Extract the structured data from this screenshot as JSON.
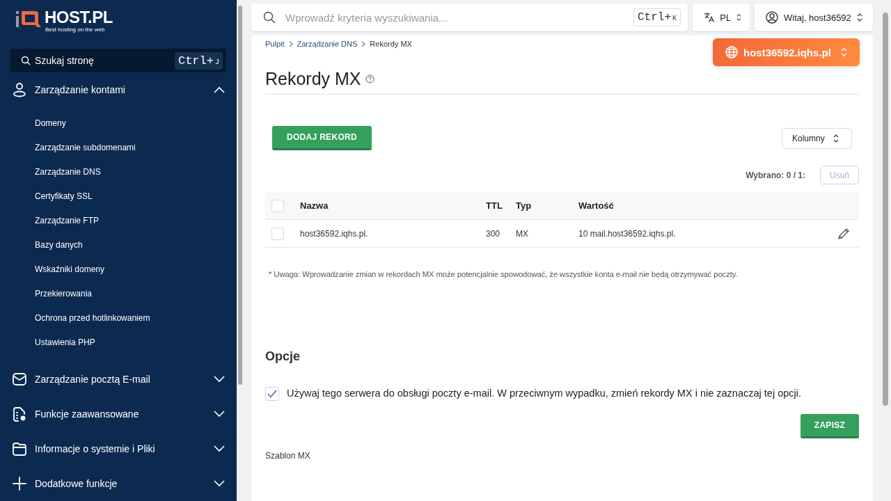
{
  "logo": {
    "name": "HOST.PL",
    "tagline": "Best hosting on the web"
  },
  "sidebar": {
    "search": {
      "placeholder": "Szukaj stronę",
      "shortcut_main": "Ctrl+",
      "shortcut_key": "J"
    },
    "groups": [
      {
        "label": "Zarządzanie kontami",
        "kind": "user",
        "expanded": true,
        "children": [
          {
            "label": "Domeny"
          },
          {
            "label": "Zarządzanie subdomenami"
          },
          {
            "label": "Zarządzanie DNS"
          },
          {
            "label": "Certyfikaty SSL"
          },
          {
            "label": "Zarządzanie FTP"
          },
          {
            "label": "Bazy danych"
          },
          {
            "label": "Wskaźniki domeny"
          },
          {
            "label": "Przekierowania"
          },
          {
            "label": "Ochrona przed hotlinkowaniem"
          },
          {
            "label": "Ustawienia PHP"
          }
        ]
      },
      {
        "label": "Zarządzanie pocztą E-mail",
        "kind": "mail",
        "expanded": false
      },
      {
        "label": "Funkcje zaawansowane",
        "kind": "doc-gear",
        "expanded": false
      },
      {
        "label": "Informacje o systemie i Pliki",
        "kind": "folder",
        "expanded": false
      },
      {
        "label": "Dodatkowe funkcje",
        "kind": "plus",
        "expanded": false
      }
    ]
  },
  "topbar": {
    "search": {
      "placeholder": "Wprowadź kryteria wyszukiwania...",
      "shortcut_main": "Ctrl+",
      "shortcut_key": "K"
    },
    "language": "PL",
    "user": "Witaj, host36592"
  },
  "breadcrumb": [
    "Pulpit",
    "Zarządzanie DNS",
    "Rekordy MX"
  ],
  "domain": "host36592.iqhs.pl",
  "title": "Rekordy MX",
  "add_button": "DODAJ REKORD",
  "columns_button": "Kolumny",
  "selected_count": "Wybrano: 0 / 1:",
  "delete_button": "Usuń",
  "table": {
    "columns": [
      "Nazwa",
      "TTL",
      "Typ",
      "Wartość"
    ],
    "header_checked": false,
    "rows": [
      {
        "checked": false,
        "cells": [
          "host36592.iqhs.pl.",
          "300",
          "MX",
          "10 mail.host36592.iqhs.pl."
        ]
      }
    ]
  },
  "note": "* Uwaga: Wprowadzanie zmian w rekordach MX może potencjalnie spowodować, że wszystkie konta e-mail nie będą otrzymywać poczty.",
  "options": {
    "heading": "Opcje",
    "checkbox": {
      "label": "Używaj tego serwera do obsługi poczty e-mail. W przeciwnym wypadku, zmień rekordy MX i nie zaznaczaj tej opcji.",
      "checked": true
    },
    "save_button": "ZAPISZ"
  },
  "next_section": "Szablon MX"
}
